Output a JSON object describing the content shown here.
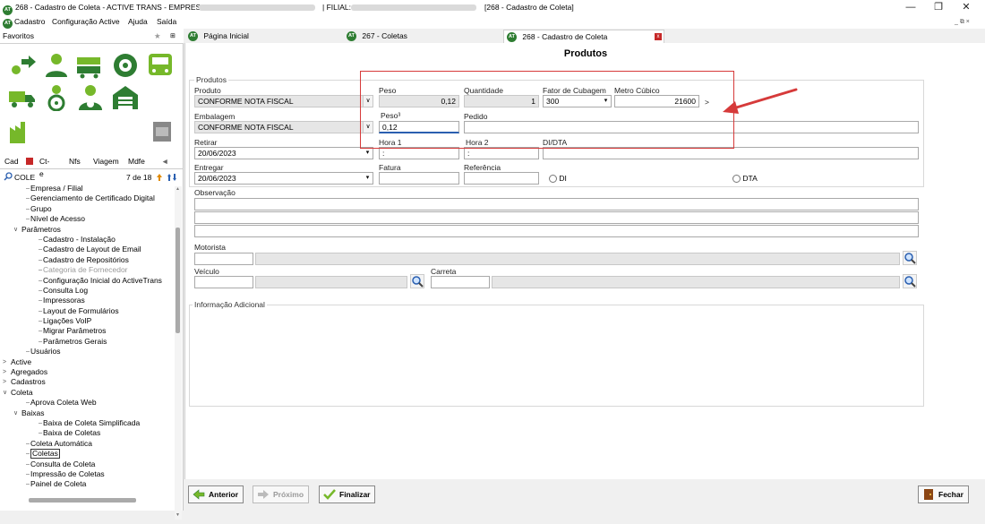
{
  "window": {
    "title_prefix": "268 - Cadastro de Coleta - ACTIVE TRANS - EMPRESA:",
    "title_filial": "| FILIAL:",
    "title_suffix": "[268 - Cadastro de Coleta]",
    "minimize": "—",
    "restore": "❐",
    "close": "✕",
    "mdi_controls": "_ ⧉ ×"
  },
  "menu": [
    "Cadastro",
    "Configuração Active",
    "Ajuda",
    "Saída"
  ],
  "favorites": {
    "label": "Favoritos",
    "star": "★",
    "pin": "⊞"
  },
  "side_tabs": [
    "Cad",
    "Ct-e",
    "Nfs",
    "Viagem",
    "Mdfe",
    "◄"
  ],
  "search": {
    "value": "COLE",
    "count": "7 de 18",
    "icon": "search-icon"
  },
  "tree": [
    {
      "label": "Empresa / Filial",
      "level": 2
    },
    {
      "label": "Gerenciamento de Certificado Digital",
      "level": 2
    },
    {
      "label": "Grupo",
      "level": 2
    },
    {
      "label": "Nível de Acesso",
      "level": 2
    },
    {
      "label": "Parâmetros",
      "level": 1,
      "exp": "∨"
    },
    {
      "label": "Cadastro - Instalação",
      "level": 3
    },
    {
      "label": "Cadastro de Layout de Email",
      "level": 3
    },
    {
      "label": "Cadastro de Repositórios",
      "level": 3
    },
    {
      "label": "Categoria de Fornecedor",
      "level": 3,
      "muted": true
    },
    {
      "label": "Configuração Inicial do ActiveTrans",
      "level": 3
    },
    {
      "label": "Consulta Log",
      "level": 3
    },
    {
      "label": "Impressoras",
      "level": 3
    },
    {
      "label": "Layout de Formulários",
      "level": 3
    },
    {
      "label": "Ligações VoIP",
      "level": 3
    },
    {
      "label": "Migrar Parâmetros",
      "level": 3
    },
    {
      "label": "Parâmetros Gerais",
      "level": 3
    },
    {
      "label": "Usuários",
      "level": 2
    },
    {
      "label": "Active",
      "level": 0,
      "exp": ">"
    },
    {
      "label": "Agregados",
      "level": 0,
      "exp": ">"
    },
    {
      "label": "Cadastros",
      "level": 0,
      "exp": ">"
    },
    {
      "label": "Coleta",
      "level": 0,
      "exp": "∨"
    },
    {
      "label": "Aprova Coleta Web",
      "level": 2
    },
    {
      "label": "Baixas",
      "level": 1,
      "exp": "∨"
    },
    {
      "label": "Baixa de Coleta Simplificada",
      "level": 3
    },
    {
      "label": "Baixa de Coletas",
      "level": 3
    },
    {
      "label": "Coleta Automática",
      "level": 2
    },
    {
      "label": "Coletas",
      "level": 2,
      "selected": true
    },
    {
      "label": "Consulta de Coleta",
      "level": 2
    },
    {
      "label": "Impressão de Coletas",
      "level": 2
    },
    {
      "label": "Painel de Coleta",
      "level": 2
    }
  ],
  "doc_tabs": [
    {
      "label": "Página Inicial"
    },
    {
      "label": "267 - Coletas"
    },
    {
      "label": "268 - Cadastro de Coleta",
      "active": true
    }
  ],
  "form": {
    "section_title": "Produtos",
    "group_label": "Produtos",
    "produto": {
      "label": "Produto",
      "value": "CONFORME NOTA FISCAL"
    },
    "peso": {
      "label": "Peso",
      "value": "0,12"
    },
    "quantidade": {
      "label": "Quantidade",
      "value": "1"
    },
    "fator": {
      "label": "Fator de Cubagem",
      "value": "300"
    },
    "metro": {
      "label": "Metro Cúbico",
      "value": "21600",
      "suffix": ">"
    },
    "embalagem": {
      "label": "Embalagem",
      "value": "CONFORME NOTA FISCAL"
    },
    "peso3": {
      "label": "Peso³",
      "value": "0,12"
    },
    "pedido": {
      "label": "Pedido",
      "value": ""
    },
    "retirar": {
      "label": "Retirar",
      "value": "20/06/2023"
    },
    "hora1": {
      "label": "Hora 1",
      "value": ":"
    },
    "hora2": {
      "label": "Hora 2",
      "value": ":"
    },
    "didta": {
      "label": "DI/DTA",
      "value": ""
    },
    "entregar": {
      "label": "Entregar",
      "value": "20/06/2023"
    },
    "fatura": {
      "label": "Fatura",
      "value": ""
    },
    "referencia": {
      "label": "Referência",
      "value": ""
    },
    "radio_di": "DI",
    "radio_dta": "DTA",
    "observacao": {
      "label": "Observação"
    },
    "motorista": {
      "label": "Motorista"
    },
    "veiculo": {
      "label": "Veículo"
    },
    "carreta": {
      "label": "Carreta"
    },
    "info": {
      "label": "Informação Adicional"
    }
  },
  "buttons": {
    "anterior": "Anterior",
    "proximo": "Próximo",
    "finalizar": "Finalizar",
    "fechar": "Fechar"
  },
  "colors": {
    "annotation": "#d63a3a",
    "brand": "#2e7d32",
    "icon_green": "#76b82a"
  }
}
